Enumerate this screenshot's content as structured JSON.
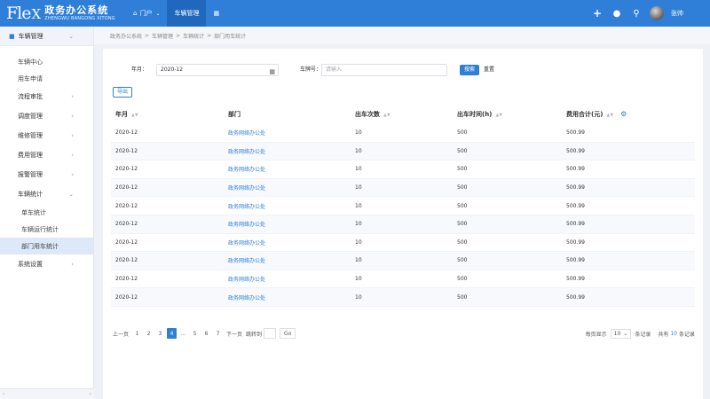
{
  "header": {
    "logo_mark": "Fle",
    "logo_mark_x": "X",
    "logo_cn": "政务办公系统",
    "logo_en": "ZHENGWU BANGONG XITONG",
    "nav": [
      {
        "label": "门户",
        "icon": "home-icon"
      },
      {
        "label": "车辆管理",
        "active": true
      },
      {
        "label": "",
        "icon": "apps-icon"
      }
    ],
    "username": "张帅"
  },
  "sidebar": {
    "top_group": "车辆管理",
    "items": [
      {
        "label": "车辆中心",
        "type": "sub"
      },
      {
        "label": "用车申请",
        "type": "sub"
      },
      {
        "label": "流程审批",
        "type": "group"
      },
      {
        "label": "调度管理",
        "type": "group"
      },
      {
        "label": "维修管理",
        "type": "group"
      },
      {
        "label": "费用管理",
        "type": "group"
      },
      {
        "label": "报警管理",
        "type": "group"
      },
      {
        "label": "车辆统计",
        "type": "group"
      },
      {
        "label": "单车统计",
        "type": "sub"
      },
      {
        "label": "车辆运行统计",
        "type": "sub"
      },
      {
        "label": "部门用车统计",
        "type": "sub",
        "active": true
      },
      {
        "label": "系统设置",
        "type": "group"
      }
    ]
  },
  "breadcrumb": [
    "政务办公系统",
    "车辆管理",
    "车辆统计",
    "部门用车统计"
  ],
  "filters": {
    "month_label": "年月：",
    "month_value": "2020-12",
    "plate_label": "车牌号：",
    "plate_placeholder": "请输入",
    "search_btn": "搜索",
    "reset_btn": "重置"
  },
  "export_btn": "导出",
  "table": {
    "headers": [
      "年月",
      "部门",
      "出车次数",
      "出车时间(h)",
      "费用合计(元)"
    ],
    "rows": [
      [
        "2020-12",
        "政务网络办公处",
        "10",
        "500",
        "500.99"
      ],
      [
        "2020-12",
        "政务网络办公处",
        "10",
        "500",
        "500.99"
      ],
      [
        "2020-12",
        "政务网络办公处",
        "10",
        "500",
        "500.99"
      ],
      [
        "2020-12",
        "政务网络办公处",
        "10",
        "500",
        "500.99"
      ],
      [
        "2020-12",
        "政务网络办公处",
        "10",
        "500",
        "500.99"
      ],
      [
        "2020-12",
        "政务网络办公处",
        "10",
        "500",
        "500.99"
      ],
      [
        "2020-12",
        "政务网络办公处",
        "10",
        "500",
        "500.99"
      ],
      [
        "2020-12",
        "政务网络办公处",
        "10",
        "500",
        "500.99"
      ],
      [
        "2020-12",
        "政务网络办公处",
        "10",
        "500",
        "500.99"
      ],
      [
        "2020-12",
        "政务网络办公处",
        "10",
        "500",
        "500.99"
      ]
    ]
  },
  "pagination": {
    "prev": "上一页",
    "pages": [
      "1",
      "2",
      "3",
      "4",
      "...",
      "5",
      "6",
      "7"
    ],
    "current": "4",
    "next": "下一页",
    "jump_label": "跳转到",
    "go": "Go",
    "per_page_label": "每页显示",
    "per_page_value": "10",
    "per_page_suffix": "条记录",
    "total_prefix": "共有",
    "total_value": "10",
    "total_suffix": "条记录"
  },
  "colors": {
    "primary": "#2f7fd8",
    "header_active": "#1f68bd"
  }
}
